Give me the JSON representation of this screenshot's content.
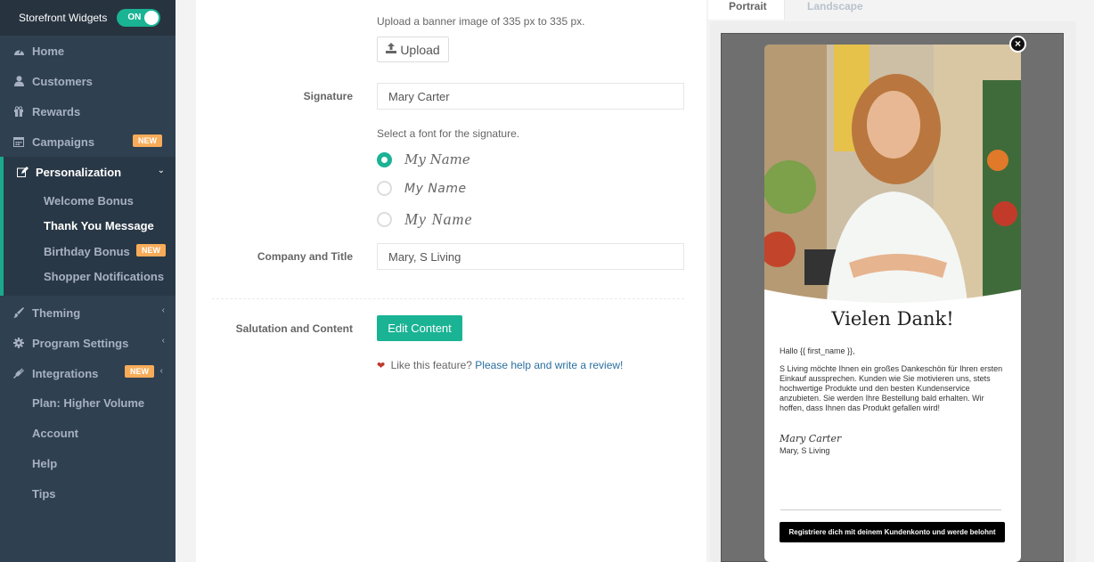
{
  "sidebar": {
    "header_label": "Storefront Widgets",
    "toggle_label": "ON",
    "items": [
      {
        "label": "Home",
        "icon": "dashboard-icon"
      },
      {
        "label": "Customers",
        "icon": "user-icon"
      },
      {
        "label": "Rewards",
        "icon": "gift-icon"
      },
      {
        "label": "Campaigns",
        "icon": "calendar-icon",
        "badge": "NEW"
      },
      {
        "label": "Personalization",
        "icon": "edit-icon"
      },
      {
        "label": "Theming",
        "icon": "brush-icon"
      },
      {
        "label": "Program Settings",
        "icon": "gear-icon"
      },
      {
        "label": "Integrations",
        "icon": "plug-icon",
        "badge": "NEW"
      }
    ],
    "subitems": [
      {
        "label": "Welcome Bonus"
      },
      {
        "label": "Thank You Message"
      },
      {
        "label": "Birthday Bonus",
        "badge": "NEW"
      },
      {
        "label": "Shopper Notifications"
      }
    ],
    "footer_items": [
      "Plan: Higher Volume",
      "Account",
      "Help",
      "Tips"
    ]
  },
  "form": {
    "banner_hint": "Upload a banner image of 335 px to 335 px.",
    "upload_label": "Upload",
    "signature_label": "Signature",
    "signature_value": "Mary Carter",
    "font_hint": "Select a font for the signature.",
    "font_options": [
      "My Name",
      "My Name",
      "My Name"
    ],
    "company_label": "Company and Title",
    "company_value": "Mary, S Living",
    "salutation_label": "Salutation and Content",
    "edit_button": "Edit Content",
    "feature_text": "Like this feature?",
    "feature_link": "Please help and write a review!"
  },
  "preview": {
    "tabs": [
      "Portrait",
      "Landscape"
    ],
    "title": "Vielen Dank!",
    "greeting": "Hallo {{ first_name }},",
    "body": "S Living möchte Ihnen ein großes Dankeschön für Ihren ersten Einkauf aussprechen. Kunden wie Sie motivieren uns, stets hochwertige Produkte und den besten Kundenservice anzubieten. Sie werden Ihre Bestellung bald erhalten. Wir hoffen, dass Ihnen das Produkt gefallen wird!",
    "signature": "Mary Carter",
    "company": "Mary, S Living",
    "cta": "Registriere dich mit deinem Kundenkonto und werde belohnt",
    "close_icon": "close-icon"
  },
  "colors": {
    "sidebar_bg": "#2f4050",
    "accent": "#1ab394",
    "badge": "#f8ac59"
  }
}
